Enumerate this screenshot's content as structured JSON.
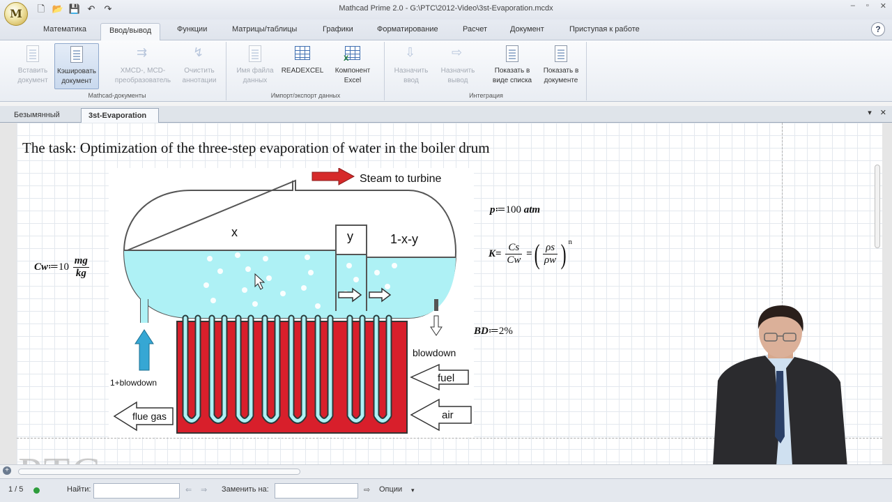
{
  "window": {
    "title": "Mathcad Prime 2.0 - G:\\PTC\\2012-Video\\3st-Evaporation.mcdx",
    "logo_text": "M",
    "min": "–",
    "max": "▫",
    "close": "✕"
  },
  "qat": {
    "new": "🗋",
    "open": "📂",
    "save": "💾",
    "undo": "↶",
    "redo": "↷"
  },
  "ribbon_tabs": [
    "Математика",
    "Ввод/вывод",
    "Функции",
    "Матрицы/таблицы",
    "Графики",
    "Форматирование",
    "Расчет",
    "Документ",
    "Приступая к работе"
  ],
  "help": "?",
  "ribbon": {
    "groups": [
      "Mathcad-документы",
      "Импорт/экспорт данных",
      "Интеграция"
    ],
    "buttons": {
      "insert_doc": "Вставить документ",
      "cache_doc": "Кэшировать документ",
      "xmcd_convert": "XMCD-, MCD-преобразователь",
      "clear_annot": "Очистить аннотации",
      "data_filename": "Имя файла данных",
      "readexcel": "READEXCEL",
      "excel_component_1": "Компонент",
      "excel_component_2": "Excel",
      "assign_input": "Назначить ввод",
      "assign_output": "Назначить вывод",
      "show_as_list": "Показать в виде списка",
      "show_in_doc": "Показать в документе"
    }
  },
  "doc_tabs": [
    "Безымянный",
    "3st-Evaporation"
  ],
  "doc_tab_controls": {
    "menu": "▾",
    "close": "✕"
  },
  "worksheet": {
    "task_text": "The task: Optimization of the three-step evaporation of water in the boiler drum",
    "diagram": {
      "steam": "Steam to turbine",
      "x": "x",
      "y": "y",
      "rest": "1-x-y",
      "blowdown_in": "1+blowdown",
      "blowdown": "blowdown",
      "fuel": "fuel",
      "air": "air",
      "flue_gas": "flue gas"
    },
    "eq_p": {
      "var": "p",
      "assign": "≔",
      "value": "100",
      "unit": "atm"
    },
    "eq_cw": {
      "var": "Cw",
      "assign": "≔",
      "value": "10",
      "unit_num": "mg",
      "unit_den": "kg"
    },
    "eq_k": {
      "lhs": "K",
      "eq1": "=",
      "num1": "Cs",
      "den1": "Cw",
      "eq2": "=",
      "num2": "ρs",
      "den2": "ρw",
      "exp": "n"
    },
    "eq_bd": {
      "var": "BD",
      "assign": "≔",
      "value": "2%"
    }
  },
  "watermark": "PTC",
  "findbar": {
    "page": "1 / 5",
    "find_label": "Найти:",
    "find_value": "",
    "replace_label": "Заменить на:",
    "replace_value": "",
    "options_label": "Опции",
    "options_arrow": "▾"
  }
}
